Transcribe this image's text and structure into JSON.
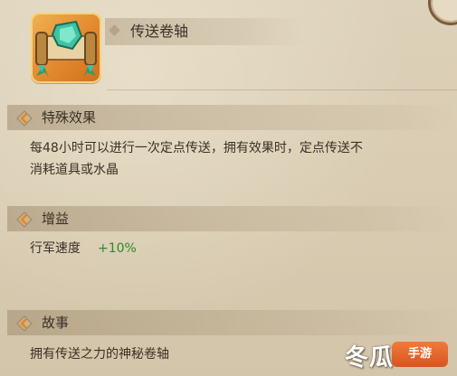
{
  "item": {
    "name": "传送卷轴",
    "icon": "scroll-crystal-icon"
  },
  "sections": [
    {
      "title": "特殊效果",
      "text_line1": "每48小时可以进行一次定点传送，拥有效果时，定点传送不",
      "text_line2": "消耗道具或水晶"
    },
    {
      "title": "增益",
      "buff_name": "行军速度",
      "buff_value": "+10%"
    },
    {
      "title": "故事",
      "text": "拥有传送之力的神秘卷轴"
    }
  ],
  "watermark": {
    "text": "冬瓜",
    "badge": "手游"
  },
  "colors": {
    "buff_value": "#2e8a2a",
    "icon_frame": "#e2892e",
    "background": "#d9ccb3"
  }
}
